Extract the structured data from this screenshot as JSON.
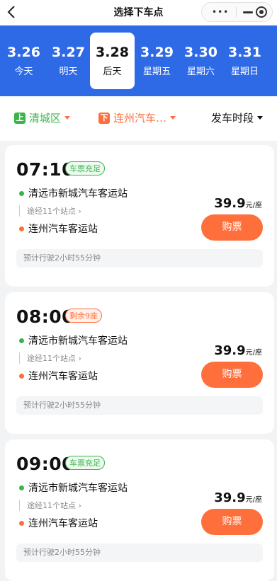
{
  "header": {
    "title": "选择下车点",
    "back_icon": "chevron-left-icon",
    "capsule": {
      "more_icon": "more-dots-icon",
      "minimize_icon": "minimize-icon",
      "close_icon": "target-icon"
    }
  },
  "colors": {
    "primary": "#2f6ae6",
    "orange": "#ff6f3c",
    "green": "#3bb54a"
  },
  "dates": [
    {
      "num": "3.26",
      "day": "今天",
      "active": false
    },
    {
      "num": "3.27",
      "day": "明天",
      "active": false
    },
    {
      "num": "3.28",
      "day": "后天",
      "active": true
    },
    {
      "num": "3.29",
      "day": "星期五",
      "active": false
    },
    {
      "num": "3.30",
      "day": "星期六",
      "active": false
    },
    {
      "num": "3.31",
      "day": "星期日",
      "active": false
    }
  ],
  "filters": {
    "origin": {
      "badge": "上",
      "label": "清城区"
    },
    "destination": {
      "badge": "下",
      "label": "连州汽车…"
    },
    "time": {
      "label": "发车时段"
    }
  },
  "trips": [
    {
      "time": "07:10",
      "tag": "车票充足",
      "tag_type": "green",
      "from": "清远市新城汽车客运站",
      "via": "途经11个站点",
      "to": "连州汽车客运站",
      "price": "39.9",
      "unit": "元/座",
      "buy": "购票",
      "estimate": "预计行驶2小时55分钟"
    },
    {
      "time": "08:00",
      "tag": "剩余9座",
      "tag_type": "orange",
      "from": "清远市新城汽车客运站",
      "via": "途经11个站点",
      "to": "连州汽车客运站",
      "price": "39.9",
      "unit": "元/座",
      "buy": "购票",
      "estimate": "预计行驶2小时55分钟"
    },
    {
      "time": "09:00",
      "tag": "车票充足",
      "tag_type": "green",
      "from": "清远市新城汽车客运站",
      "via": "途经11个站点",
      "to": "连州汽车客运站",
      "price": "39.9",
      "unit": "元/座",
      "buy": "购票",
      "estimate": "预计行驶2小时55分钟"
    }
  ]
}
